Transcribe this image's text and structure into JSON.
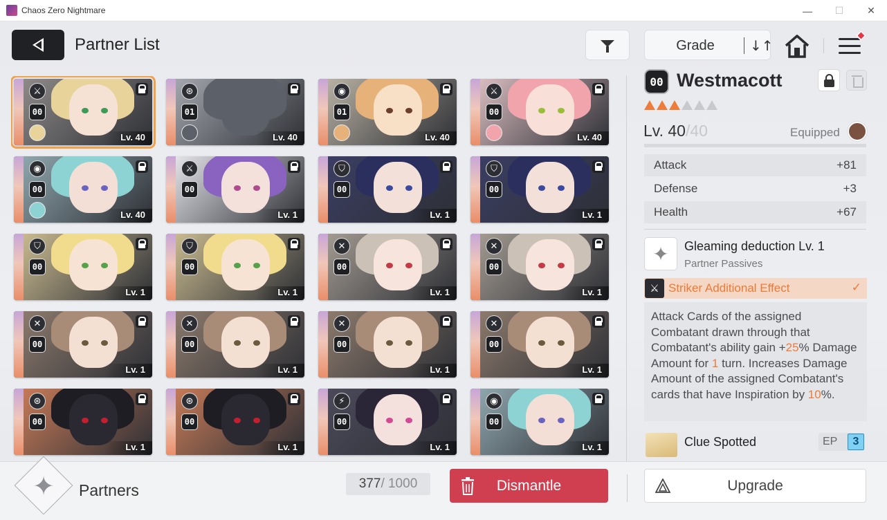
{
  "window": {
    "title": "Chaos Zero Nightmare",
    "minimize": "—",
    "maximize": "☐",
    "close": "✕"
  },
  "header": {
    "title": "Partner List",
    "sort_label": "Grade",
    "sort_icon": "↓↑"
  },
  "cards": [
    {
      "class": "⚔",
      "grade": "00",
      "level": "Lv. 40",
      "equipped": true,
      "selected": true,
      "palette": {
        "hair": "#e8d39a",
        "skin": "#f6e2d4",
        "eye": "#3e9a57",
        "bg": "#8e8a88"
      }
    },
    {
      "class": "⊛",
      "grade": "01",
      "level": "Lv. 40",
      "equipped": true,
      "selected": false,
      "palette": {
        "hair": "#5b6069",
        "skin": "#5b6069",
        "eye": "#5b6069",
        "bg": "#a3a7ad"
      }
    },
    {
      "class": "◉",
      "grade": "01",
      "level": "Lv. 40",
      "equipped": true,
      "selected": false,
      "palette": {
        "hair": "#e7b27a",
        "skin": "#f7e0c6",
        "eye": "#6b3f2a",
        "bg": "#b7b0a2"
      }
    },
    {
      "class": "⚔",
      "grade": "00",
      "level": "Lv. 40",
      "equipped": true,
      "selected": false,
      "palette": {
        "hair": "#f2a4ad",
        "skin": "#f8dfd8",
        "eye": "#9bbd3a",
        "bg": "#d8bcbf"
      }
    },
    {
      "class": "◉",
      "grade": "00",
      "level": "Lv. 40",
      "equipped": true,
      "selected": false,
      "palette": {
        "hair": "#8ed3d4",
        "skin": "#f3dfd5",
        "eye": "#6b63c0",
        "bg": "#8fa6ad"
      }
    },
    {
      "class": "⚔",
      "grade": "00",
      "level": "Lv. 1",
      "equipped": false,
      "selected": false,
      "palette": {
        "hair": "#8a63c0",
        "skin": "#f4e1dc",
        "eye": "#b14b8f",
        "bg": "#e3e3e8"
      }
    },
    {
      "class": "⛉",
      "grade": "00",
      "level": "Lv. 1",
      "equipped": false,
      "selected": false,
      "palette": {
        "hair": "#2b2f5e",
        "skin": "#f3e1d9",
        "eye": "#3a4aa0",
        "bg": "#3b3e63"
      }
    },
    {
      "class": "⛉",
      "grade": "00",
      "level": "Lv. 1",
      "equipped": false,
      "selected": false,
      "palette": {
        "hair": "#2b2f5e",
        "skin": "#f3e1d9",
        "eye": "#3a4aa0",
        "bg": "#3b3e63"
      }
    },
    {
      "class": "⛉",
      "grade": "00",
      "level": "Lv. 1",
      "equipped": false,
      "selected": false,
      "palette": {
        "hair": "#f1dc8d",
        "skin": "#f7e3d4",
        "eye": "#58a14c",
        "bg": "#c8b98e"
      }
    },
    {
      "class": "⛉",
      "grade": "00",
      "level": "Lv. 1",
      "equipped": false,
      "selected": false,
      "palette": {
        "hair": "#f1dc8d",
        "skin": "#f7e3d4",
        "eye": "#58a14c",
        "bg": "#c8b98e"
      }
    },
    {
      "class": "✕",
      "grade": "00",
      "level": "Lv. 1",
      "equipped": false,
      "selected": false,
      "palette": {
        "hair": "#cbc1b6",
        "skin": "#f6e4dd",
        "eye": "#c33b45",
        "bg": "#a29a91"
      }
    },
    {
      "class": "✕",
      "grade": "00",
      "level": "Lv. 1",
      "equipped": false,
      "selected": false,
      "palette": {
        "hair": "#cbc1b6",
        "skin": "#f6e4dd",
        "eye": "#c33b45",
        "bg": "#a29a91"
      }
    },
    {
      "class": "✕",
      "grade": "00",
      "level": "Lv. 1",
      "equipped": false,
      "selected": false,
      "palette": {
        "hair": "#a98c78",
        "skin": "#f4e0d3",
        "eye": "#6d5a3c",
        "bg": "#8c7a6c"
      }
    },
    {
      "class": "✕",
      "grade": "00",
      "level": "Lv. 1",
      "equipped": false,
      "selected": false,
      "palette": {
        "hair": "#a98c78",
        "skin": "#f4e0d3",
        "eye": "#6d5a3c",
        "bg": "#8c7a6c"
      }
    },
    {
      "class": "✕",
      "grade": "00",
      "level": "Lv. 1",
      "equipped": false,
      "selected": false,
      "palette": {
        "hair": "#a98c78",
        "skin": "#f4e0d3",
        "eye": "#6d5a3c",
        "bg": "#8c7a6c"
      }
    },
    {
      "class": "✕",
      "grade": "00",
      "level": "Lv. 1",
      "equipped": false,
      "selected": false,
      "palette": {
        "hair": "#a98c78",
        "skin": "#f4e0d3",
        "eye": "#6d5a3c",
        "bg": "#8c7a6c"
      }
    },
    {
      "class": "⊛",
      "grade": "00",
      "level": "Lv. 1",
      "equipped": false,
      "selected": false,
      "palette": {
        "hair": "#1f1d24",
        "skin": "#2a2830",
        "eye": "#c21f2f",
        "bg": "#c57a57"
      }
    },
    {
      "class": "⊛",
      "grade": "00",
      "level": "Lv. 1",
      "equipped": false,
      "selected": false,
      "palette": {
        "hair": "#1f1d24",
        "skin": "#2a2830",
        "eye": "#c21f2f",
        "bg": "#c57a57"
      }
    },
    {
      "class": "⚡",
      "grade": "00",
      "level": "Lv. 1",
      "equipped": false,
      "selected": false,
      "palette": {
        "hair": "#2a2638",
        "skin": "#f4e0dc",
        "eye": "#d34a92",
        "bg": "#4c4a5a"
      }
    },
    {
      "class": "◉",
      "grade": "00",
      "level": "Lv. 1",
      "equipped": false,
      "selected": false,
      "palette": {
        "hair": "#8ed3d4",
        "skin": "#f3dfd5",
        "eye": "#6b63c0",
        "bg": "#8fa6ad"
      }
    }
  ],
  "detail": {
    "grade": "00",
    "name": "Westmacott",
    "stars_filled": 3,
    "stars_total": 6,
    "level_current": "Lv. 40",
    "level_max": "/40",
    "equipped_label": "Equipped",
    "stats": [
      {
        "name": "Attack",
        "value": "+81"
      },
      {
        "name": "Defense",
        "value": "+3"
      },
      {
        "name": "Health",
        "value": "+67"
      }
    ],
    "passive": {
      "icon": "✦",
      "name": "Gleaming deduction Lv. 1",
      "subtitle": "Partner Passives"
    },
    "effect": {
      "icon": "⚔",
      "label": "Striker Additional Effect",
      "check": "✓"
    },
    "description": {
      "p1": "Attack Cards of the assigned Combatant drawn through that Combatant's ability gain +",
      "p1_hl": "25",
      "p2": "% Damage Amount for ",
      "p2_hl": "1",
      "p3": " turn. Increases Damage Amount of the assigned Combatant's cards that have Inspiration by ",
      "p3_hl": "10",
      "p4": "%."
    },
    "clue": {
      "name": "Clue Spotted",
      "ep_label": "EP",
      "ep_value": "3"
    }
  },
  "bottom": {
    "emblem_icon": "✦",
    "partners_label": "Partners",
    "count_current": "377",
    "count_total": " / 1000",
    "dismantle_label": "Dismantle",
    "upgrade_label": "Upgrade"
  }
}
